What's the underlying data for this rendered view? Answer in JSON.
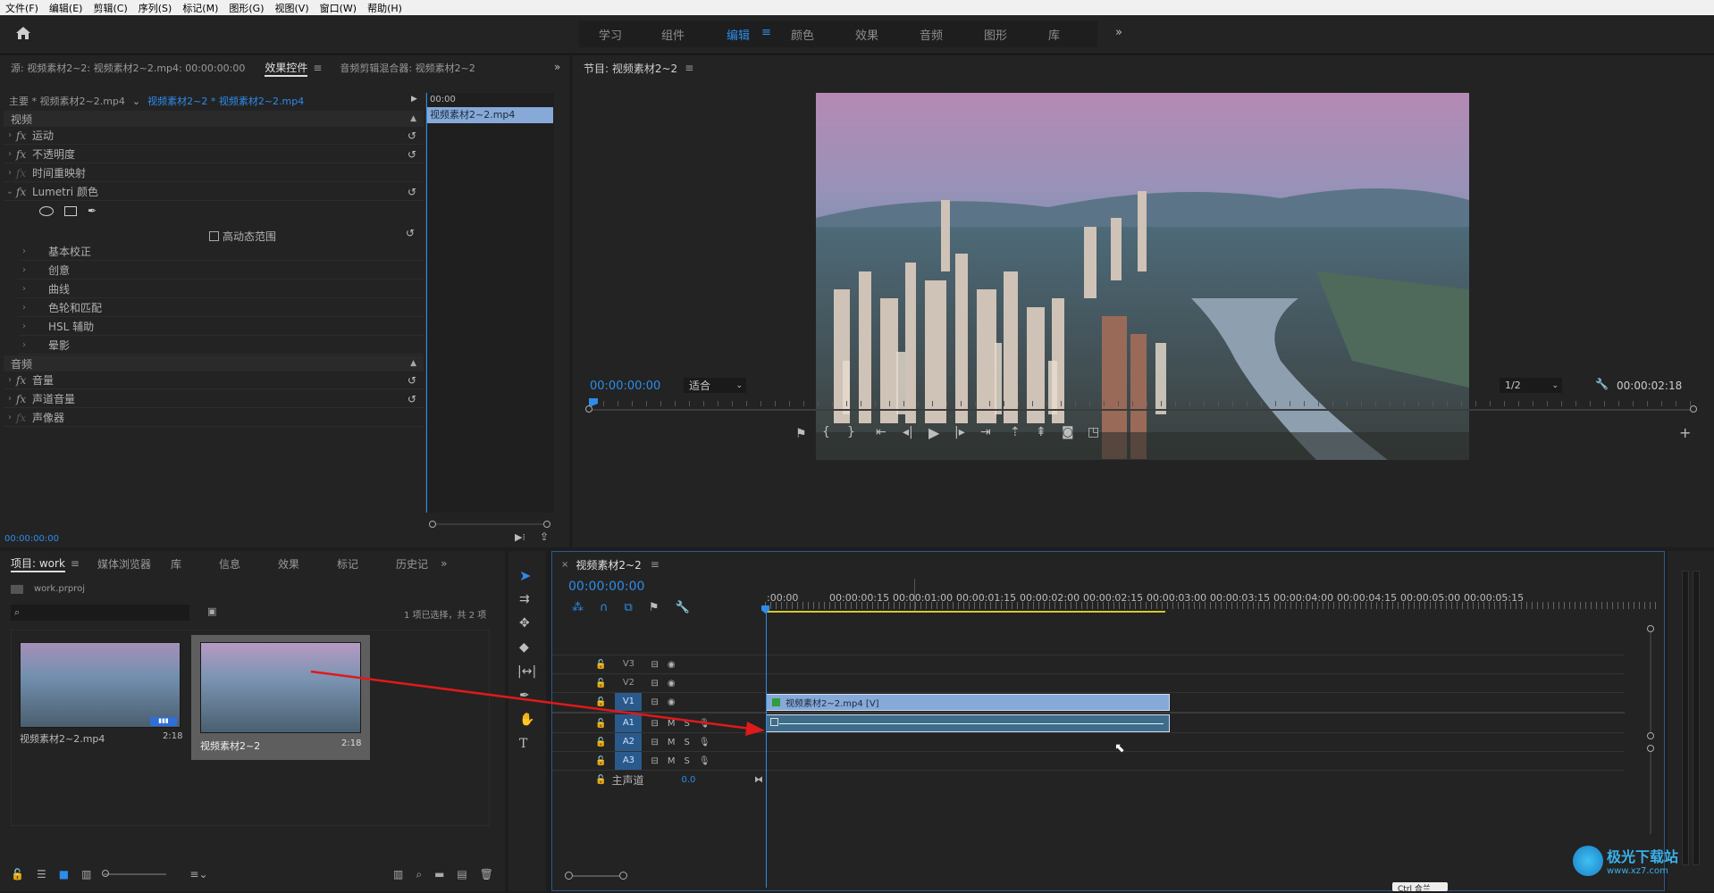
{
  "menu": [
    "文件(F)",
    "编辑(E)",
    "剪辑(C)",
    "序列(S)",
    "标记(M)",
    "图形(G)",
    "视图(V)",
    "窗口(W)",
    "帮助(H)"
  ],
  "workspaces": [
    "学习",
    "组件",
    "编辑",
    "颜色",
    "效果",
    "音频",
    "图形",
    "库"
  ],
  "source_panel": {
    "tabs": [
      "源: 视频素材2~2: 视频素材2~2.mp4: 00:00:00:00",
      "效果控件",
      "音频剪辑混合器: 视频素材2~2"
    ],
    "master": "主要 * 视频素材2~2.mp4",
    "sequence": "视频素材2~2 * 视频素材2~2.mp4",
    "mini_time": "00:00",
    "mini_clip": "视频素材2~2.mp4",
    "video_header": "视频",
    "video_effects": [
      "运动",
      "不透明度",
      "时间重映射",
      "Lumetri 颜色"
    ],
    "hdr_label": "高动态范围",
    "lumetri_items": [
      "基本校正",
      "创意",
      "曲线",
      "色轮和匹配",
      "HSL 辅助",
      "晕影"
    ],
    "audio_header": "音频",
    "audio_effects": [
      "音量",
      "声道音量",
      "声像器"
    ],
    "bottom_time": "00:00:00:00"
  },
  "program": {
    "title": "节目: 视频素材2~2",
    "timecode": "00:00:00:00",
    "fit": "适合",
    "resolution": "1/2",
    "duration": "00:00:02:18"
  },
  "project": {
    "tabs": [
      "项目: work",
      "媒体浏览器",
      "库",
      "信息",
      "效果",
      "标记",
      "历史记"
    ],
    "file": "work.prproj",
    "selection": "1 项已选择，共 2 项",
    "items": [
      {
        "name": "视频素材2~2.mp4",
        "dur": "2:18"
      },
      {
        "name": "视频素材2~2",
        "dur": "2:18"
      }
    ]
  },
  "timeline": {
    "title": "视频素材2~2",
    "timecode": "00:00:00:00",
    "ruler": [
      ":00:00",
      "00:00:00:15",
      "00:00:01:00",
      "00:00:01:15",
      "00:00:02:00",
      "00:00:02:15",
      "00:00:03:00",
      "00:00:03:15",
      "00:00:04:00",
      "00:00:04:15",
      "00:00:05:00",
      "00:00:05:15"
    ],
    "tracks_v": [
      "V3",
      "V2",
      "V1"
    ],
    "tracks_a": [
      "A1",
      "A2",
      "A3"
    ],
    "master": "主声道",
    "master_val": "0.0",
    "clip_v": "视频素材2~2.mp4 [V]",
    "m": "M",
    "s": "S"
  },
  "watermark": "极光下载站",
  "watermark_url": "www.xz7.com",
  "tooltip": "Ctrl 合兰"
}
